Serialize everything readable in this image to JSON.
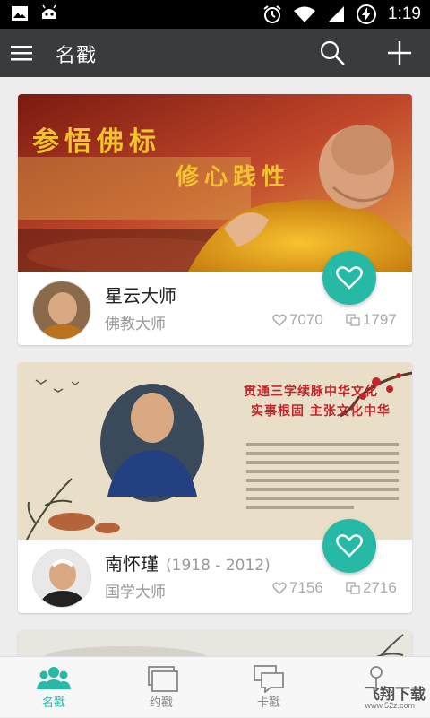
{
  "status_bar": {
    "time": "1:19"
  },
  "app_bar": {
    "title": "名戳"
  },
  "cards": [
    {
      "banner_text_1": "参悟佛标",
      "banner_text_2": "修心践性",
      "name": "星云大师",
      "years": "",
      "category": "佛教大师",
      "likes": "7070",
      "shares": "1797"
    },
    {
      "banner_text_1": "贯通三学续脉中华文化",
      "banner_text_2": "实事根固 主张文化中华",
      "name": "南怀瑾",
      "years": "(1918 - 2012)",
      "category": "国学大师",
      "likes": "7156",
      "shares": "2716"
    }
  ],
  "bottom_nav": {
    "items": [
      {
        "label": "名戳",
        "active": true
      },
      {
        "label": "约戳",
        "active": false
      },
      {
        "label": "卡戳",
        "active": false
      },
      {
        "label": "",
        "active": false
      }
    ]
  },
  "watermark": {
    "line1": "飞翔下载",
    "line2": "www.52z.com"
  },
  "colors": {
    "accent": "#26b9a6",
    "app_bar": "#3a3b3d"
  }
}
